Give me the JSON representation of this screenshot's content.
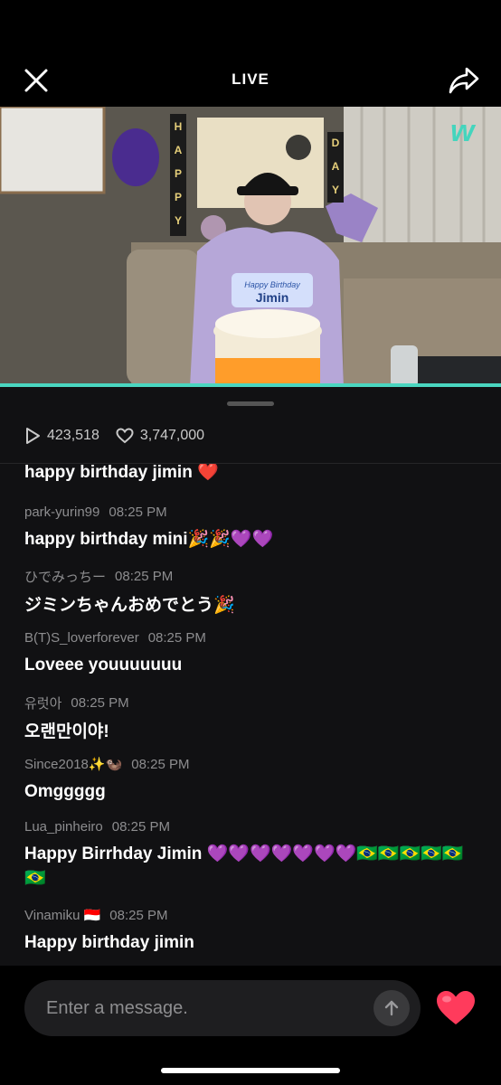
{
  "header": {
    "title": "LIVE",
    "close_icon": "close-icon",
    "share_icon": "share-icon"
  },
  "video": {
    "banner_letters_left": [
      "H",
      "A",
      "P",
      "P",
      "Y"
    ],
    "banner_letters_right": [
      "D",
      "A",
      "Y"
    ],
    "cap_text": "Happy Birthday",
    "cap_name": "Jimin",
    "watermark": "w",
    "progress_fraction": 1.0,
    "accent_color": "#4ad6c0"
  },
  "stats": {
    "plays": "423,518",
    "likes": "3,747,000"
  },
  "messages": [
    {
      "user": "",
      "time": "",
      "text": "happy birthday jimin ❤️"
    },
    {
      "user": "park-yurin99",
      "time": "08:25 PM",
      "text": "happy birthday mini🎉🎉💜💜"
    },
    {
      "user": "ひでみっちー",
      "time": "08:25 PM",
      "text": "ジミンちゃんおめでとう🎉"
    },
    {
      "user": "B(T)S_loverforever",
      "time": "08:25 PM",
      "text": "Loveee youuuuuuu"
    },
    {
      "user": "유럿아",
      "time": "08:25 PM",
      "text": "오랜만이야!"
    },
    {
      "user": "Since2018✨🦦",
      "time": "08:25 PM",
      "text": "Omggggg"
    },
    {
      "user": "Lua_pinheiro",
      "time": "08:25 PM",
      "text": "Happy Birrhday Jimin 💜💜💜💜💜💜💜🇧🇷🇧🇷🇧🇷🇧🇷🇧🇷🇧🇷"
    },
    {
      "user": "Vinamiku 🇮🇩",
      "time": "08:25 PM",
      "text": "Happy birthday jimin"
    }
  ],
  "composer": {
    "placeholder": "Enter a message.",
    "send_icon": "arrow-up-icon",
    "heart_icon": "heart-icon",
    "heart_color": "#ff3b5c"
  }
}
